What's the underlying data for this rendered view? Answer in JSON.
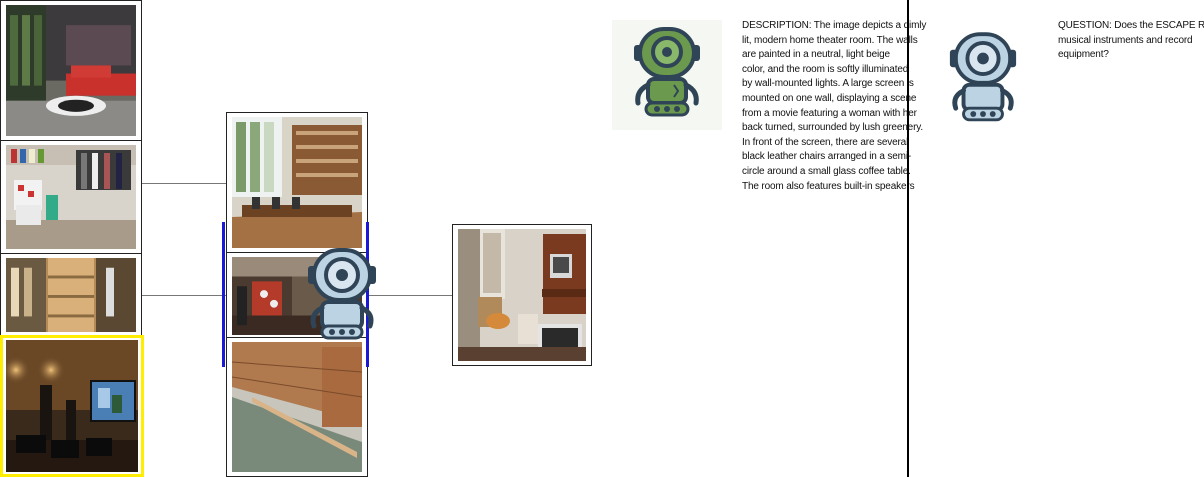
{
  "description": {
    "text": "DESCRIPTION: The image depicts a dimly\nlit, modern home theater room. The walls\nare painted in a neutral, light beige\ncolor, and the room is softly illuminated\nby wall-mounted lights. A large screen is\nmounted on one wall, displaying a scene\nfrom a movie featuring a woman with her\nback turned, surrounded by lush greenery.\nIn front of the screen, there are several\nblack leather chairs arranged in a semi-\ncircle around a small glass coffee table.\nThe room also features built-in speakers"
  },
  "question": {
    "text": "QUESTION: Does the ESCAPE ROOM\nmusical instruments and record\nequipment?"
  },
  "colors": {
    "highlight": "#ffee00",
    "selection": "#1a1ad6",
    "robot_green": "#6b9a4e",
    "robot_blue": "#b7cfe0",
    "robot_outline": "#2f4456"
  },
  "icons": {
    "describer": "green-robot-icon",
    "answerer": "blue-robot-icon",
    "selector": "blue-robot-icon"
  }
}
